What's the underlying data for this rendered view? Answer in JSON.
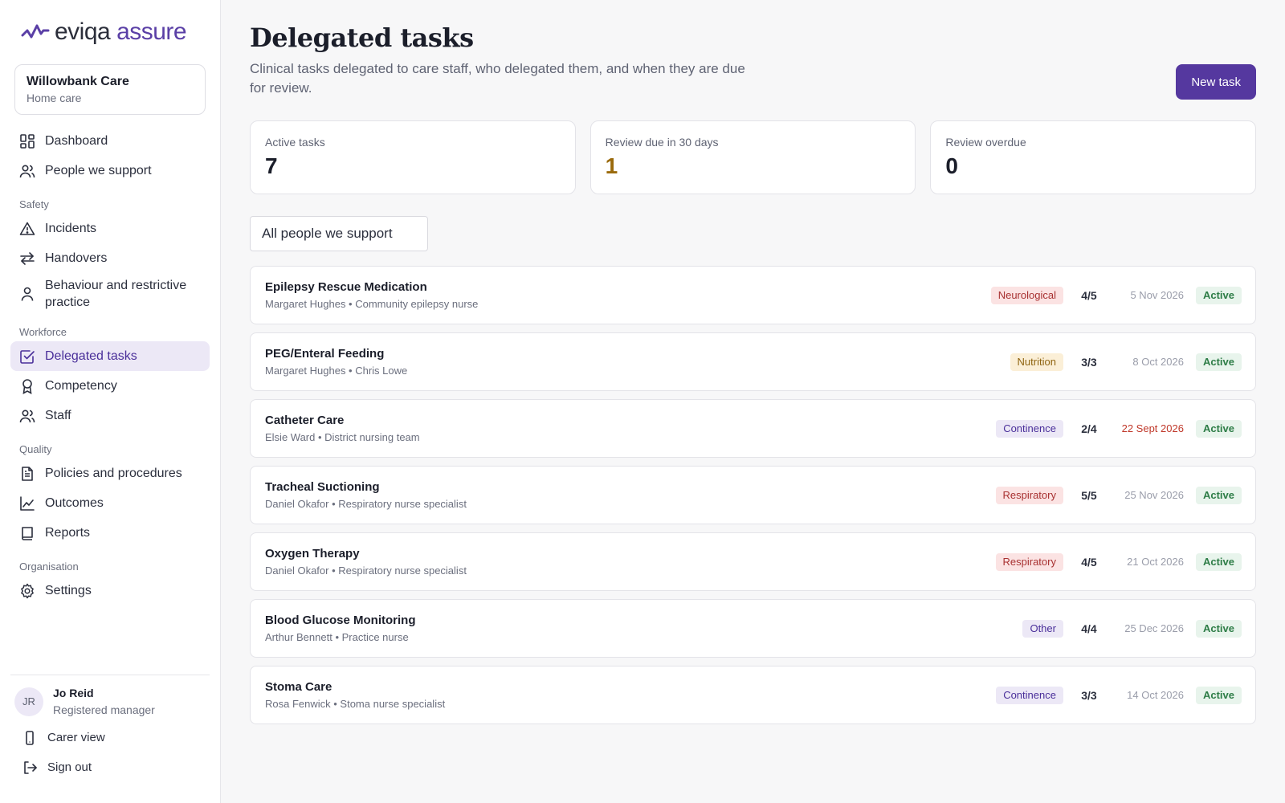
{
  "brand": {
    "part1": "eviqa",
    "part2": "assure"
  },
  "org": {
    "name": "Willowbank Care",
    "type": "Home care"
  },
  "nav": {
    "dashboard": "Dashboard",
    "people": "People we support",
    "safety_heading": "Safety",
    "incidents": "Incidents",
    "handovers": "Handovers",
    "behaviour": "Behaviour and restrictive practice",
    "workforce_heading": "Workforce",
    "delegated": "Delegated tasks",
    "competency": "Competency",
    "staff": "Staff",
    "quality_heading": "Quality",
    "policies": "Policies and procedures",
    "outcomes": "Outcomes",
    "reports": "Reports",
    "organisation_heading": "Organisation",
    "settings": "Settings"
  },
  "user": {
    "initials": "JR",
    "name": "Jo Reid",
    "role": "Registered manager",
    "carer_view": "Carer view",
    "sign_out": "Sign out"
  },
  "page": {
    "title": "Delegated tasks",
    "description": "Clinical tasks delegated to care staff, who delegated them, and when they are due for review.",
    "new_task": "New task"
  },
  "stats": [
    {
      "label": "Active tasks",
      "value": "7",
      "color": "#1b1e2a"
    },
    {
      "label": "Review due in 30 days",
      "value": "1",
      "color": "#9a6a0c"
    },
    {
      "label": "Review overdue",
      "value": "0",
      "color": "#1b1e2a"
    }
  ],
  "filter": {
    "label": "All people we support"
  },
  "categories": {
    "Neurological": {
      "bg": "#fbe3e3",
      "fg": "#a83232"
    },
    "Nutrition": {
      "bg": "#fbefd7",
      "fg": "#8f6410"
    },
    "Continence": {
      "bg": "#ece8f6",
      "fg": "#4a2f9a"
    },
    "Respiratory": {
      "bg": "#fbe3e3",
      "fg": "#a83232"
    },
    "Other": {
      "bg": "#ece8f6",
      "fg": "#4a2f9a"
    }
  },
  "tasks": [
    {
      "name": "Epilepsy Rescue Medication",
      "meta": "Margaret Hughes • Community epilepsy nurse",
      "category": "Neurological",
      "progress": "4/5",
      "review": "5 Nov 2026",
      "overdue": false,
      "status": "Active"
    },
    {
      "name": "PEG/Enteral Feeding",
      "meta": "Margaret Hughes • Chris Lowe",
      "category": "Nutrition",
      "progress": "3/3",
      "review": "8 Oct 2026",
      "overdue": false,
      "status": "Active"
    },
    {
      "name": "Catheter Care",
      "meta": "Elsie Ward • District nursing team",
      "category": "Continence",
      "progress": "2/4",
      "review": "22 Sept 2026",
      "overdue": true,
      "status": "Active"
    },
    {
      "name": "Tracheal Suctioning",
      "meta": "Daniel Okafor • Respiratory nurse specialist",
      "category": "Respiratory",
      "progress": "5/5",
      "review": "25 Nov 2026",
      "overdue": false,
      "status": "Active"
    },
    {
      "name": "Oxygen Therapy",
      "meta": "Daniel Okafor • Respiratory nurse specialist",
      "category": "Respiratory",
      "progress": "4/5",
      "review": "21 Oct 2026",
      "overdue": false,
      "status": "Active"
    },
    {
      "name": "Blood Glucose Monitoring",
      "meta": "Arthur Bennett • Practice nurse",
      "category": "Other",
      "progress": "4/4",
      "review": "25 Dec 2026",
      "overdue": false,
      "status": "Active"
    },
    {
      "name": "Stoma Care",
      "meta": "Rosa Fenwick • Stoma nurse specialist",
      "category": "Continence",
      "progress": "3/3",
      "review": "14 Oct 2026",
      "overdue": false,
      "status": "Active"
    }
  ]
}
